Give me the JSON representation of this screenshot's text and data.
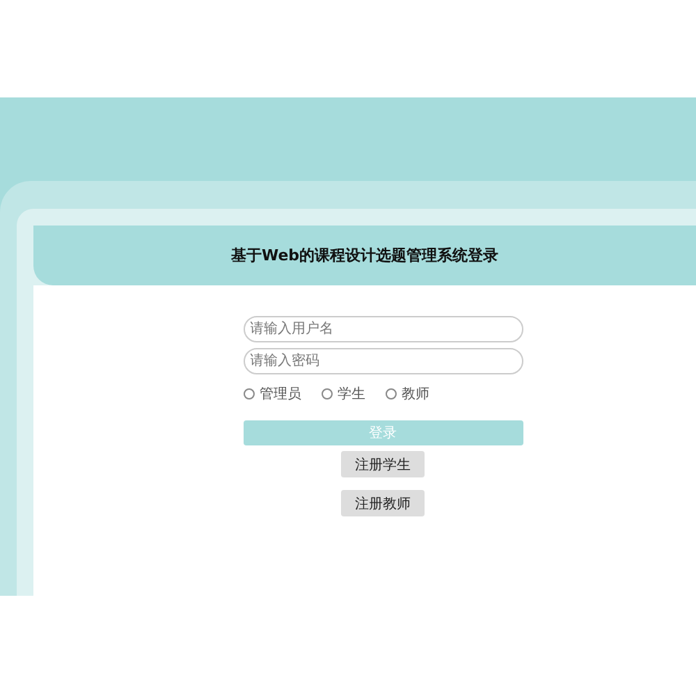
{
  "title": "基于Web的课程设计选题管理系统登录",
  "fields": [
    {
      "placeholder": "请输入用户名"
    },
    {
      "placeholder": "请输入密码"
    }
  ],
  "roles": [
    {
      "label": "管理员",
      "selected": false
    },
    {
      "label": "学生",
      "selected": false
    },
    {
      "label": "教师",
      "selected": false
    }
  ],
  "login_button": "登录",
  "register_buttons": [
    "注册学生",
    "注册教师"
  ]
}
